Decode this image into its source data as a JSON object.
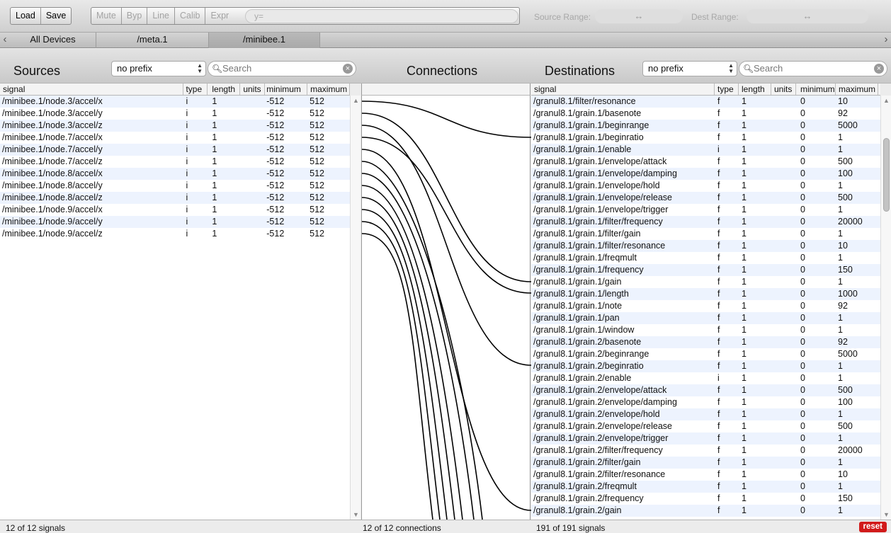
{
  "toolbar": {
    "load_label": "Load",
    "save_label": "Save",
    "mute_label": "Mute",
    "byp_label": "Byp",
    "line_label": "Line",
    "calib_label": "Calib",
    "expr_label": "Expr",
    "expr_placeholder": "y=",
    "source_range_label": "Source Range:",
    "dest_range_label": "Dest Range:",
    "range_arrow": "↔"
  },
  "tabs": [
    {
      "label": "All Devices",
      "active": false
    },
    {
      "label": "/meta.1",
      "active": false
    },
    {
      "label": "/minibee.1",
      "active": true
    }
  ],
  "sources": {
    "title": "Sources",
    "prefix": "no prefix",
    "search_placeholder": "Search",
    "columns": [
      "signal",
      "type",
      "length",
      "units",
      "minimum",
      "maximum"
    ],
    "rows": [
      [
        "/minibee.1/node.3/accel/x",
        "i",
        "1",
        "",
        "-512",
        "512"
      ],
      [
        "/minibee.1/node.3/accel/y",
        "i",
        "1",
        "",
        "-512",
        "512"
      ],
      [
        "/minibee.1/node.3/accel/z",
        "i",
        "1",
        "",
        "-512",
        "512"
      ],
      [
        "/minibee.1/node.7/accel/x",
        "i",
        "1",
        "",
        "-512",
        "512"
      ],
      [
        "/minibee.1/node.7/accel/y",
        "i",
        "1",
        "",
        "-512",
        "512"
      ],
      [
        "/minibee.1/node.7/accel/z",
        "i",
        "1",
        "",
        "-512",
        "512"
      ],
      [
        "/minibee.1/node.8/accel/x",
        "i",
        "1",
        "",
        "-512",
        "512"
      ],
      [
        "/minibee.1/node.8/accel/y",
        "i",
        "1",
        "",
        "-512",
        "512"
      ],
      [
        "/minibee.1/node.8/accel/z",
        "i",
        "1",
        "",
        "-512",
        "512"
      ],
      [
        "/minibee.1/node.9/accel/x",
        "i",
        "1",
        "",
        "-512",
        "512"
      ],
      [
        "/minibee.1/node.9/accel/y",
        "i",
        "1",
        "",
        "-512",
        "512"
      ],
      [
        "/minibee.1/node.9/accel/z",
        "i",
        "1",
        "",
        "-512",
        "512"
      ]
    ],
    "status": "12 of 12 signals"
  },
  "connections": {
    "title": "Connections",
    "status": "12 of 12 connections",
    "line_color": "#000000"
  },
  "destinations": {
    "title": "Destinations",
    "prefix": "no prefix",
    "search_placeholder": "Search",
    "columns": [
      "signal",
      "type",
      "length",
      "units",
      "minimum",
      "maximum"
    ],
    "rows": [
      [
        "/granul8.1/filter/resonance",
        "f",
        "1",
        "",
        "0",
        "10"
      ],
      [
        "/granul8.1/grain.1/basenote",
        "f",
        "1",
        "",
        "0",
        "92"
      ],
      [
        "/granul8.1/grain.1/beginrange",
        "f",
        "1",
        "",
        "0",
        "5000"
      ],
      [
        "/granul8.1/grain.1/beginratio",
        "f",
        "1",
        "",
        "0",
        "1"
      ],
      [
        "/granul8.1/grain.1/enable",
        "i",
        "1",
        "",
        "0",
        "1"
      ],
      [
        "/granul8.1/grain.1/envelope/attack",
        "f",
        "1",
        "",
        "0",
        "500"
      ],
      [
        "/granul8.1/grain.1/envelope/damping",
        "f",
        "1",
        "",
        "0",
        "100"
      ],
      [
        "/granul8.1/grain.1/envelope/hold",
        "f",
        "1",
        "",
        "0",
        "1"
      ],
      [
        "/granul8.1/grain.1/envelope/release",
        "f",
        "1",
        "",
        "0",
        "500"
      ],
      [
        "/granul8.1/grain.1/envelope/trigger",
        "f",
        "1",
        "",
        "0",
        "1"
      ],
      [
        "/granul8.1/grain.1/filter/frequency",
        "f",
        "1",
        "",
        "0",
        "20000"
      ],
      [
        "/granul8.1/grain.1/filter/gain",
        "f",
        "1",
        "",
        "0",
        "1"
      ],
      [
        "/granul8.1/grain.1/filter/resonance",
        "f",
        "1",
        "",
        "0",
        "10"
      ],
      [
        "/granul8.1/grain.1/freqmult",
        "f",
        "1",
        "",
        "0",
        "1"
      ],
      [
        "/granul8.1/grain.1/frequency",
        "f",
        "1",
        "",
        "0",
        "150"
      ],
      [
        "/granul8.1/grain.1/gain",
        "f",
        "1",
        "",
        "0",
        "1"
      ],
      [
        "/granul8.1/grain.1/length",
        "f",
        "1",
        "",
        "0",
        "1000"
      ],
      [
        "/granul8.1/grain.1/note",
        "f",
        "1",
        "",
        "0",
        "92"
      ],
      [
        "/granul8.1/grain.1/pan",
        "f",
        "1",
        "",
        "0",
        "1"
      ],
      [
        "/granul8.1/grain.1/window",
        "f",
        "1",
        "",
        "0",
        "1"
      ],
      [
        "/granul8.1/grain.2/basenote",
        "f",
        "1",
        "",
        "0",
        "92"
      ],
      [
        "/granul8.1/grain.2/beginrange",
        "f",
        "1",
        "",
        "0",
        "5000"
      ],
      [
        "/granul8.1/grain.2/beginratio",
        "f",
        "1",
        "",
        "0",
        "1"
      ],
      [
        "/granul8.1/grain.2/enable",
        "i",
        "1",
        "",
        "0",
        "1"
      ],
      [
        "/granul8.1/grain.2/envelope/attack",
        "f",
        "1",
        "",
        "0",
        "500"
      ],
      [
        "/granul8.1/grain.2/envelope/damping",
        "f",
        "1",
        "",
        "0",
        "100"
      ],
      [
        "/granul8.1/grain.2/envelope/hold",
        "f",
        "1",
        "",
        "0",
        "1"
      ],
      [
        "/granul8.1/grain.2/envelope/release",
        "f",
        "1",
        "",
        "0",
        "500"
      ],
      [
        "/granul8.1/grain.2/envelope/trigger",
        "f",
        "1",
        "",
        "0",
        "1"
      ],
      [
        "/granul8.1/grain.2/filter/frequency",
        "f",
        "1",
        "",
        "0",
        "20000"
      ],
      [
        "/granul8.1/grain.2/filter/gain",
        "f",
        "1",
        "",
        "0",
        "1"
      ],
      [
        "/granul8.1/grain.2/filter/resonance",
        "f",
        "1",
        "",
        "0",
        "10"
      ],
      [
        "/granul8.1/grain.2/freqmult",
        "f",
        "1",
        "",
        "0",
        "1"
      ],
      [
        "/granul8.1/grain.2/frequency",
        "f",
        "1",
        "",
        "0",
        "150"
      ],
      [
        "/granul8.1/grain.2/gain",
        "f",
        "1",
        "",
        "0",
        "1"
      ]
    ],
    "status": "191 of 191 signals"
  },
  "reset_label": "reset"
}
